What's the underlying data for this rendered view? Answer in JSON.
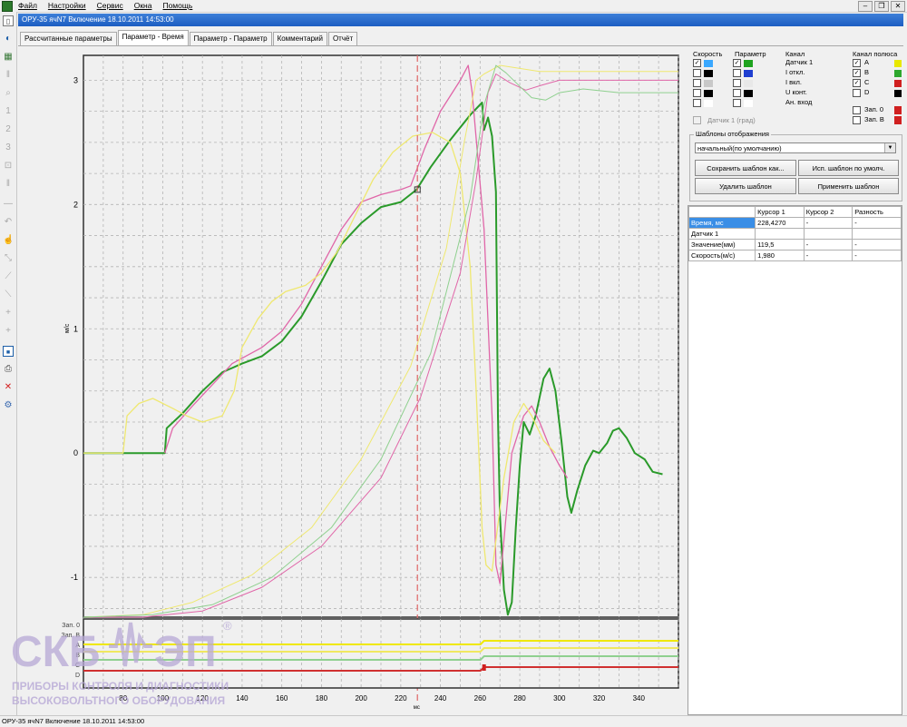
{
  "menu": {
    "items": [
      "Файл",
      "Настройки",
      "Сервис",
      "Окна",
      "Помощь"
    ]
  },
  "window": {
    "title": "ОРУ-35 ячN7 Включение 18.10.2011 14:53:00"
  },
  "tabs": [
    {
      "label": "Рассчитанные параметры",
      "active": false
    },
    {
      "label": "Параметр - Время",
      "active": true
    },
    {
      "label": "Параметр - Параметр",
      "active": false
    },
    {
      "label": "Комментарий",
      "active": false
    },
    {
      "label": "Отчёт",
      "active": false
    }
  ],
  "channels": {
    "col_speed": "Скорость",
    "col_param": "Параметр",
    "col_channel": "Канал",
    "col_pole": "Канал полюса",
    "rows": [
      {
        "label": "Датчик 1",
        "speed_checked": true,
        "param_checked": true,
        "speed_color": "#3aa8ff",
        "param_color": "#1fa31f"
      },
      {
        "label": "I откл.",
        "speed_checked": false,
        "param_checked": false,
        "speed_color": "#000000",
        "param_color": "#1f3fd0"
      },
      {
        "label": "I вкл.",
        "speed_checked": false,
        "param_checked": false,
        "speed_color": "#c8c8c8",
        "param_color": "#e8e8e8"
      },
      {
        "label": "U конт.",
        "speed_checked": false,
        "param_checked": false,
        "speed_color": "#000000",
        "param_color": "#000000"
      },
      {
        "label": "Ан. вход",
        "speed_checked": false,
        "param_checked": false,
        "speed_color": "#ffffff",
        "param_color": "#ffffff"
      }
    ],
    "sensor_angle": "Датчик 1 (град)",
    "poles": [
      {
        "label": "A",
        "checked": true,
        "color": "#e8e800"
      },
      {
        "label": "B",
        "checked": true,
        "color": "#2ea82e"
      },
      {
        "label": "C",
        "checked": true,
        "color": "#d02020"
      },
      {
        "label": "D",
        "checked": false,
        "color": "#000000"
      }
    ],
    "zap": [
      {
        "label": "Зап. 0",
        "checked": false,
        "color": "#d02020"
      },
      {
        "label": "Зап. В",
        "checked": false,
        "color": "#d02020"
      }
    ]
  },
  "templates": {
    "title": "Шаблоны отображения",
    "selected": "начальный(по умолчанию)",
    "btn_save_as": "Сохранить шаблон как...",
    "btn_use_default": "Исп. шаблон по умолч.",
    "btn_delete": "Удалить шаблон",
    "btn_apply": "Применить шаблон"
  },
  "cursor_table": {
    "headers": [
      "",
      "Курсор 1",
      "Курсор 2",
      "Разность"
    ],
    "rows": [
      [
        "Время, мс",
        "228,4270",
        "-",
        "-"
      ],
      [
        "Датчик 1",
        "",
        "",
        ""
      ],
      [
        "Значение(мм)",
        "119,5",
        "-",
        "-"
      ],
      [
        "Скорость(м/с)",
        "1,980",
        "-",
        "-"
      ]
    ]
  },
  "plot": {
    "y_unit": "м/с",
    "x_unit": "мс",
    "cursor_ms": 228.4,
    "lane_labels": [
      "Зап. 0",
      "Зап. В",
      "A",
      "B",
      "C",
      "D"
    ]
  },
  "chart_data": {
    "type": "line",
    "x_ticks": [
      80,
      100,
      120,
      140,
      160,
      180,
      200,
      220,
      240,
      260,
      280,
      300,
      320,
      340
    ],
    "y_ticks": [
      -1,
      0,
      1,
      2,
      3
    ],
    "xlim": [
      60,
      360
    ],
    "ylim": [
      -1.32,
      3.2
    ],
    "grid": true,
    "series": [
      {
        "color": "#2a9a2a",
        "width": 2,
        "points": [
          [
            60,
            0
          ],
          [
            101,
            0
          ],
          [
            102,
            0.2
          ],
          [
            110,
            0.32
          ],
          [
            120,
            0.5
          ],
          [
            130,
            0.65
          ],
          [
            140,
            0.72
          ],
          [
            150,
            0.78
          ],
          [
            160,
            0.9
          ],
          [
            170,
            1.1
          ],
          [
            180,
            1.38
          ],
          [
            190,
            1.68
          ],
          [
            200,
            1.85
          ],
          [
            210,
            1.98
          ],
          [
            220,
            2.02
          ],
          [
            228,
            2.12
          ],
          [
            235,
            2.3
          ],
          [
            245,
            2.52
          ],
          [
            255,
            2.72
          ],
          [
            261,
            2.82
          ],
          [
            262,
            2.6
          ],
          [
            264,
            2.7
          ],
          [
            266,
            2.55
          ],
          [
            268,
            2.1
          ],
          [
            269,
            0.3
          ],
          [
            270,
            -0.5
          ],
          [
            272,
            -1.1
          ],
          [
            274,
            -1.3
          ],
          [
            276,
            -1.2
          ],
          [
            278,
            -0.6
          ],
          [
            280,
            -0.1
          ],
          [
            282,
            0.25
          ],
          [
            285,
            0.15
          ],
          [
            288,
            0.3
          ],
          [
            292,
            0.6
          ],
          [
            295,
            0.68
          ],
          [
            298,
            0.5
          ],
          [
            301,
            0.1
          ],
          [
            304,
            -0.35
          ],
          [
            306,
            -0.48
          ],
          [
            309,
            -0.3
          ],
          [
            313,
            -0.1
          ],
          [
            317,
            0.02
          ],
          [
            320,
            0
          ],
          [
            324,
            0.08
          ],
          [
            327,
            0.18
          ],
          [
            330,
            0.2
          ],
          [
            334,
            0.12
          ],
          [
            338,
            0
          ],
          [
            343,
            -0.05
          ],
          [
            347,
            -0.15
          ],
          [
            352,
            -0.17
          ]
        ]
      },
      {
        "color": "#e066a8",
        "width": 1.3,
        "points": [
          [
            101,
            0
          ],
          [
            105,
            0.2
          ],
          [
            115,
            0.38
          ],
          [
            125,
            0.55
          ],
          [
            135,
            0.72
          ],
          [
            150,
            0.85
          ],
          [
            160,
            0.98
          ],
          [
            170,
            1.2
          ],
          [
            180,
            1.5
          ],
          [
            190,
            1.8
          ],
          [
            200,
            2.02
          ],
          [
            210,
            2.08
          ],
          [
            220,
            2.12
          ],
          [
            225,
            2.15
          ],
          [
            232,
            2.45
          ],
          [
            240,
            2.75
          ],
          [
            250,
            3.0
          ],
          [
            254,
            3.12
          ],
          [
            256,
            2.9
          ],
          [
            262,
            1.8
          ],
          [
            266,
            0.3
          ],
          [
            268,
            -0.9
          ],
          [
            270,
            -1.05
          ],
          [
            272,
            -0.7
          ],
          [
            276,
            0
          ],
          [
            282,
            0.3
          ],
          [
            286,
            0.38
          ],
          [
            290,
            0.25
          ],
          [
            295,
            0.05
          ],
          [
            300,
            -0.1
          ],
          [
            304,
            -0.2
          ]
        ]
      },
      {
        "color": "#efe870",
        "width": 1.3,
        "points": [
          [
            60,
            0
          ],
          [
            80,
            0
          ],
          [
            82,
            0.3
          ],
          [
            88,
            0.4
          ],
          [
            95,
            0.44
          ],
          [
            105,
            0.36
          ],
          [
            112,
            0.3
          ],
          [
            120,
            0.25
          ],
          [
            130,
            0.3
          ],
          [
            136,
            0.5
          ],
          [
            140,
            0.85
          ],
          [
            148,
            1.08
          ],
          [
            155,
            1.22
          ],
          [
            162,
            1.3
          ],
          [
            172,
            1.35
          ],
          [
            180,
            1.45
          ],
          [
            188,
            1.62
          ],
          [
            196,
            1.88
          ],
          [
            206,
            2.2
          ],
          [
            216,
            2.42
          ],
          [
            226,
            2.55
          ],
          [
            236,
            2.58
          ],
          [
            245,
            2.5
          ],
          [
            250,
            2.25
          ],
          [
            255,
            1.5
          ],
          [
            258,
            0.5
          ],
          [
            261,
            -0.6
          ],
          [
            263,
            -0.9
          ],
          [
            266,
            -0.95
          ],
          [
            268,
            -0.7
          ],
          [
            272,
            -0.2
          ],
          [
            277,
            0.25
          ],
          [
            282,
            0.4
          ],
          [
            286,
            0.3
          ],
          [
            292,
            0.1
          ],
          [
            298,
            0
          ]
        ]
      },
      {
        "color": "#e066a8",
        "width": 1,
        "points": [
          [
            60,
            -1.32
          ],
          [
            90,
            -1.32
          ],
          [
            120,
            -1.27
          ],
          [
            150,
            -1.08
          ],
          [
            180,
            -0.75
          ],
          [
            210,
            -0.2
          ],
          [
            230,
            0.45
          ],
          [
            250,
            1.45
          ],
          [
            258,
            2.2
          ],
          [
            264,
            2.9
          ],
          [
            268,
            3.05
          ],
          [
            275,
            2.98
          ],
          [
            283,
            2.92
          ],
          [
            291,
            2.96
          ],
          [
            300,
            3.0
          ],
          [
            320,
            3.0
          ],
          [
            360,
            3.0
          ]
        ]
      },
      {
        "color": "#efe870",
        "width": 1,
        "points": [
          [
            60,
            -1.32
          ],
          [
            90,
            -1.3
          ],
          [
            115,
            -1.2
          ],
          [
            145,
            -0.98
          ],
          [
            175,
            -0.6
          ],
          [
            200,
            -0.05
          ],
          [
            225,
            0.7
          ],
          [
            243,
            1.65
          ],
          [
            252,
            2.5
          ],
          [
            258,
            3.0
          ],
          [
            262,
            3.05
          ],
          [
            270,
            3.12
          ],
          [
            290,
            3.07
          ],
          [
            320,
            3.07
          ],
          [
            360,
            3.07
          ]
        ]
      },
      {
        "color": "#8fd08f",
        "width": 1,
        "points": [
          [
            60,
            -1.32
          ],
          [
            95,
            -1.3
          ],
          [
            125,
            -1.22
          ],
          [
            155,
            -1.0
          ],
          [
            185,
            -0.6
          ],
          [
            210,
            -0.05
          ],
          [
            235,
            0.8
          ],
          [
            255,
            2.05
          ],
          [
            262,
            2.8
          ],
          [
            268,
            3.12
          ],
          [
            273,
            3.06
          ],
          [
            280,
            2.95
          ],
          [
            286,
            2.86
          ],
          [
            293,
            2.84
          ],
          [
            300,
            2.9
          ],
          [
            312,
            2.93
          ],
          [
            330,
            2.9
          ],
          [
            360,
            2.9
          ]
        ]
      }
    ],
    "lanes": [
      {
        "color": "#efe800",
        "level_before": 0,
        "level_after": 0,
        "step_ms": 262
      },
      {
        "color": "#f0e860",
        "level_before": 0,
        "level_after": 0,
        "step_ms": 262
      },
      {
        "color": "#8fd08f",
        "level_before": 0,
        "level_after": 0,
        "step_ms": 262
      },
      {
        "color": "#d03030",
        "level_before": 0,
        "level_after": 0,
        "step_ms": 262
      }
    ]
  },
  "statusbar": {
    "text": "ОРУ-35 ячN7 Включение 18.10.2011 14:53:00"
  },
  "watermark": {
    "logo_left": "СКБ",
    "logo_right": "ЭП",
    "registered": "®",
    "line1": "ПРИБОРЫ КОНТРОЛЯ И ДИАГНОСТИКИ",
    "line2": "ВЫСОКОВОЛЬТНОГО ОБОРУДОВАНИЯ"
  }
}
